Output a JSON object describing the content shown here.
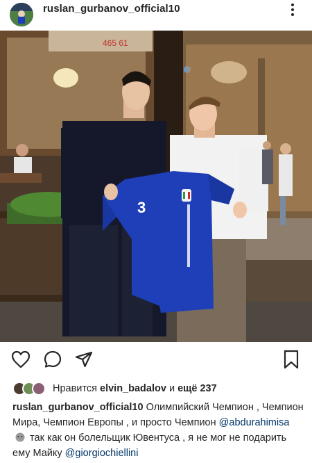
{
  "post": {
    "username": "ruslan_gurbanov_official10",
    "more_icon": "more-vertical-icon",
    "photo": {
      "jersey_number": "3",
      "storefront_sign": "465 61"
    },
    "actions": {
      "like_icon": "heart-icon",
      "comment_icon": "comment-icon",
      "share_icon": "direct-share-icon",
      "save_icon": "bookmark-icon"
    },
    "likes": {
      "prefix": "Нравится",
      "user": "elvin_badalov",
      "conjunction": "и",
      "rest": "ещё 237"
    },
    "caption": {
      "author": "ruslan_gurbanov_official10",
      "text1": "Олимпийский Чемпион , Чемпион Мира, Чемпион Европы , и просто Чемпион",
      "mention1": "@abdurahimisa",
      "text2": "так как он болельщик Ювентуса , я не мог не подарить ему Майку",
      "mention2": "@giorgiochiellini"
    }
  },
  "colors": {
    "text": "#262626",
    "link": "#003569",
    "jersey_blue": "#1f3fb8"
  }
}
